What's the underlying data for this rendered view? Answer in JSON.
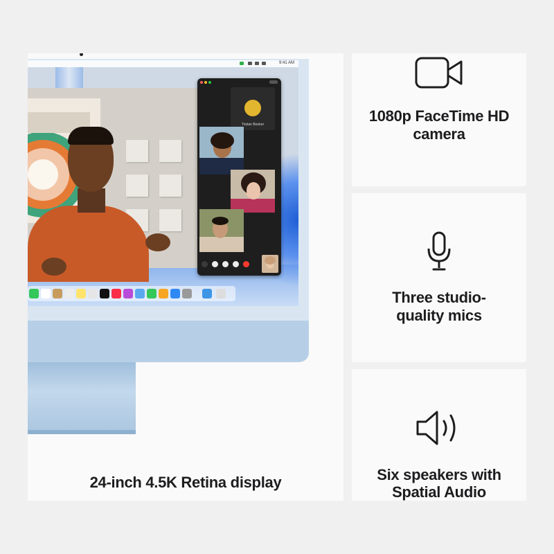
{
  "display": {
    "caption": "24-inch 4.5K Retina display",
    "menubar_time": "9:41 AM",
    "facetime": {
      "contact_name": "Tristan Booker"
    }
  },
  "features": [
    {
      "icon": "video-camera-icon",
      "caption_line1": "1080p FaceTime HD",
      "caption_line2": "camera"
    },
    {
      "icon": "microphone-icon",
      "caption_line1": "Three studio-",
      "caption_line2": "quality mics"
    },
    {
      "icon": "speaker-icon",
      "caption_line1": "Six speakers with",
      "caption_line2": "Spatial Audio"
    }
  ],
  "colors": {
    "background": "#f0f0f1",
    "tile": "#fafafa",
    "text": "#1d1d1f",
    "imac_blue": "#b7cfe6",
    "facetime_end": "#ff3b30"
  }
}
